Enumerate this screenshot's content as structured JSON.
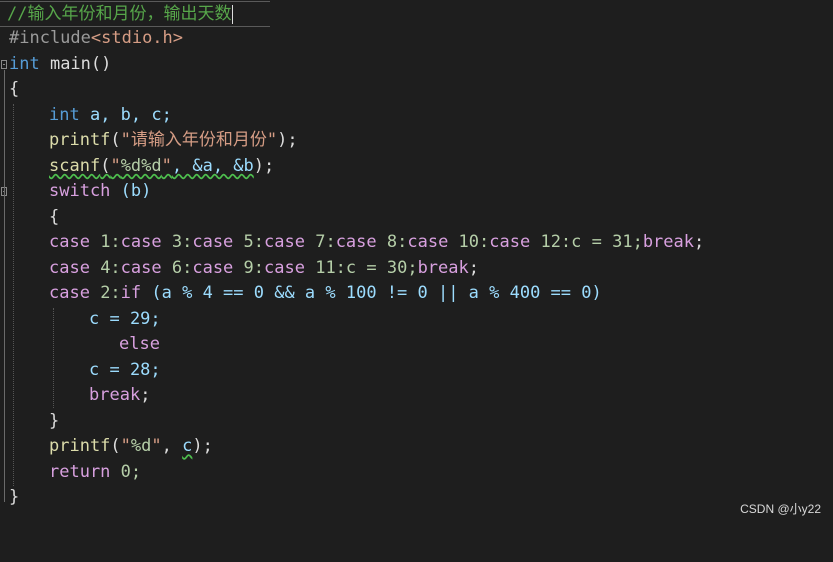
{
  "lines": {
    "l0_comment": "//输入年份和月份，输出天数",
    "l1_include": "#include",
    "l1_header": "<stdio.h>",
    "l2_int": "int",
    "l2_main": " main()",
    "l3_brace": "{",
    "l4_int": "int",
    "l4_vars": " a, b, c;",
    "l5_printf": "printf",
    "l5_open": "(",
    "l5_str": "\"请输入年份和月份\"",
    "l5_close": ");",
    "l6_scanf": "scanf",
    "l6_open": "(",
    "l6_q1": "\"",
    "l6_fmt": "%d%d",
    "l6_q2": "\"",
    "l6_args": ", &a, &b",
    "l6_close": ");",
    "l7_switch": "switch",
    "l7_cond": " (b)",
    "l8_brace": "{",
    "l9_case": "case",
    "l9_rest": " 1:",
    "l9_c2": "case",
    "l9_r2": " 3:",
    "l9_c3": "case",
    "l9_r3": " 5:",
    "l9_c4": "case",
    "l9_r4": " 7:",
    "l9_c5": "case",
    "l9_r5": " 8:",
    "l9_c6": "case",
    "l9_r6": " 10:",
    "l9_c7": "case",
    "l9_r7": " 12:c = 31;",
    "l9_break": "break",
    "l9_end": ";",
    "l10_c1": "case",
    "l10_r1": " 4:",
    "l10_c2": "case",
    "l10_r2": " 6:",
    "l10_c3": "case",
    "l10_r3": " 9:",
    "l10_c4": "case",
    "l10_r4": " 11:c = 30;",
    "l10_break": "break",
    "l10_end": ";",
    "l11_case": "case",
    "l11_num": " 2:",
    "l11_if": "if",
    "l11_cond": " (a % 4 == 0 && a % 100 != 0 || a % 400 == 0)",
    "l12_stmt": "c = 29;",
    "l13_else": "else",
    "l14_stmt": "c = 28;",
    "l15_break": "break",
    "l15_end": ";",
    "l16_brace": "}",
    "l17_printf": "printf",
    "l17_open": "(",
    "l17_q1": "\"",
    "l17_fmt": "%d",
    "l17_q2": "\"",
    "l17_comma": ", ",
    "l17_c": "c",
    "l17_close": ");",
    "l18_return": "return",
    "l18_rest": " 0;",
    "l19_brace": "}"
  },
  "watermark": "CSDN @小y22",
  "colors": {
    "background": "#1e1e1e",
    "keyword": "#569cd6",
    "control_keyword": "#d8a0df",
    "function": "#dcdcaa",
    "string": "#d69d85",
    "comment": "#57a64a",
    "plain": "#dcdcdc"
  }
}
